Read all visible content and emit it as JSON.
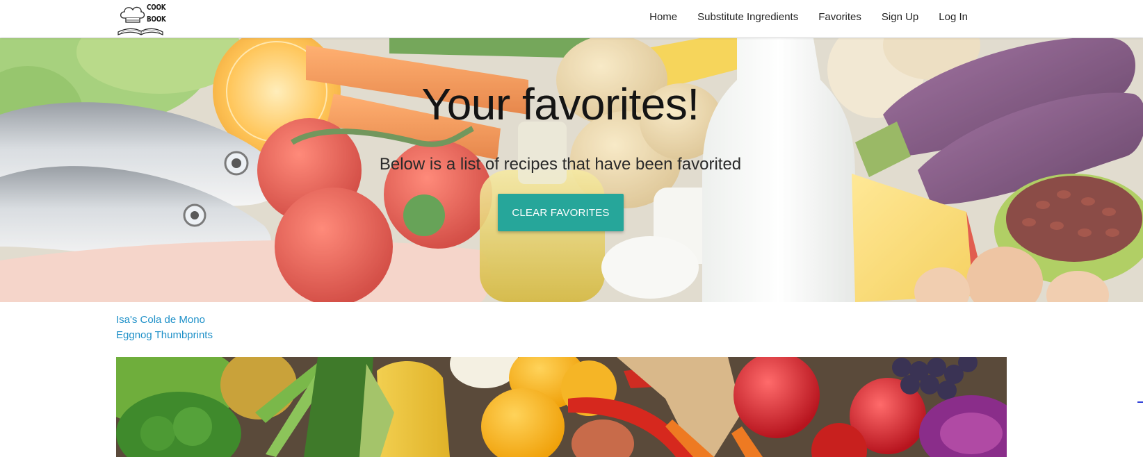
{
  "brand": {
    "logo_line1": "COOK",
    "logo_line2": "BOOK"
  },
  "nav": {
    "items": [
      "Home",
      "Substitute Ingredients",
      "Favorites",
      "Sign Up",
      "Log In"
    ]
  },
  "hero": {
    "title": "Your favorites!",
    "subtitle": "Below is a list of recipes that have been favorited",
    "clear_button_label": "CLEAR FAVORITES",
    "button_color": "#26a69a"
  },
  "favorites": [
    "Isa's Cola de Mono",
    "Eggnog Thumbprints"
  ],
  "colors": {
    "link": "#1e90c8",
    "accent": "#26a69a"
  }
}
